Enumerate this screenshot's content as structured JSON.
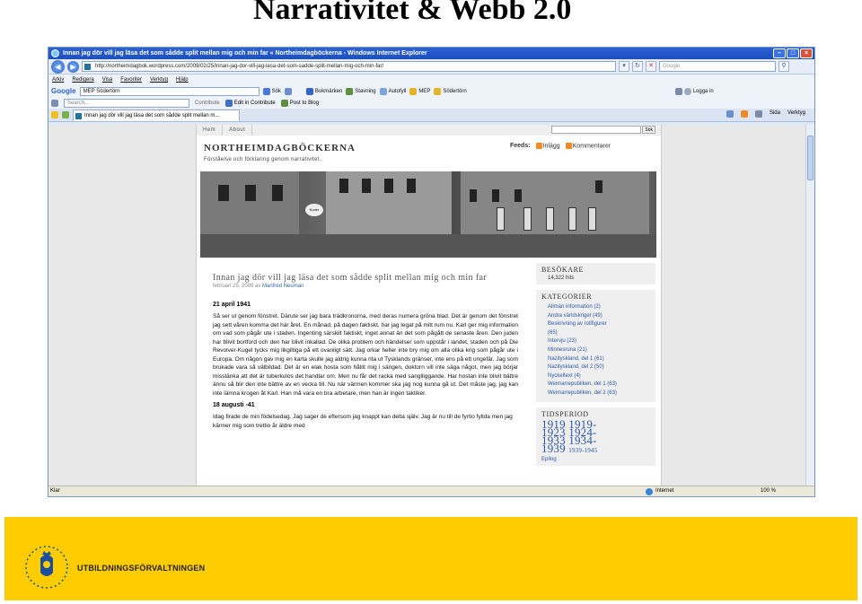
{
  "slide": {
    "title": "Narrativitet & Webb 2.0",
    "org_name": "UTBILDNINGSFÖRVALTNINGEN",
    "logo_letters": "S·T·O·C·K·H·O·L·M·S·S·T·A·D"
  },
  "browser": {
    "window_title": "Innan jag dör vill jag läsa det som sådde split mellan mig och min far « Northeimdagböckerna - Windows Internet Explorer",
    "url": "http://northeimdagbok.wordpress.com/2009/02/25/innan-jag-dor-vill-jag-lasa-det-som-sadde-split-mellan-mig-och-min-far/",
    "search_placeholder": "Google",
    "menu": [
      "Arkiv",
      "Redigera",
      "Visa",
      "Favoriter",
      "Verktyg",
      "Hjälp"
    ],
    "google_toolbar": {
      "logo": "Google",
      "search_value": "MEP Södertörn",
      "items": [
        "Sök",
        "Bokmärken",
        "Stavning",
        "Autofyll",
        "MEP",
        "Södertörn"
      ],
      "login": "Logga in"
    },
    "mep_toolbar": {
      "search_placeholder": "Search...",
      "items": [
        "Contribute",
        "Edit in Contribute",
        "Post to Blog"
      ]
    },
    "tab_label": "Innan jag dör vill jag läsa det som sådde split mellan m...",
    "tab_tools": [
      "Sida",
      "Verktyg"
    ],
    "status": {
      "left": "Klar",
      "zone": "Internet",
      "zoom": "100 %"
    }
  },
  "blog": {
    "nav": [
      "Hem",
      "About"
    ],
    "search_button": "Sök",
    "title": "Northeimdagböckerna",
    "subtitle": "Förståelse och förklaring genom narrativitet.",
    "feeds_label": "Feeds:",
    "feeds": [
      "Inlägg",
      "Kommentarer"
    ],
    "banner_sign": "Kurier",
    "post": {
      "title": "Innan jag dör vill jag läsa det som sådde split mellan mig och min far",
      "date_prefix": "februari 25, 2009 av",
      "author": "Manfred Neuman",
      "entry1_date": "21 april 1941",
      "entry1_text": "Så ser ut genom fönstret. Därute ser jag bara trädkronorna, med deras numera gröna blad. Det är genom det fönstret jag sett våren komma det här året. En månad, på dagen faktiskt, har jag legat på mitt rum nu. Karl ger mig information om vad som pågår ute i staden. Ingenting särskilt faktiskt, inget annat än det som pågått de senaste åren. Den juden har blivit bortford och den har blivit inkallad. De olika problem och händelser som uppstår i landet, staden och på Die Revolver-Kugel tycks mig likgiltiga på ett ovanligt sätt. Jag orkar heller inte bry mig om alla olika krig som pågår ute i Europa. Om någon gav mig en karta skulle jag aldrig kunna rita ut Tysklands gränser, inte ens på ett ungefär. Jag som brukade vara så välbildad. Det är en elak hosta som hållit mig i sängen, doktorn vill inte säga något, men jag börjar misstänka att det är tuberkulos det handlar om. Men nu får det racka med sanglliggande. Har hostan inte blivit bättre ännu så blir den inte bättre av en vecka till. Nu när värmen kommer ska jag nog kunna gå ut. Det måste jag, jag kan inte lämna krogen åt Karl. Han må vara en bra arbetare, men han är ingen taktiker.",
      "entry2_date": "18 augusti -41",
      "entry2_text": "Idag firade de min födelsedag. Jag sager de eftersom jag knappt kan delta själv. Jag är nu till de fyrtio fyllda men jag känner mig som trettio år äldre med"
    },
    "sidebar": {
      "visitors_title": "Besökare",
      "visitors_count": "14,322 hits",
      "categories_title": "Kategorier",
      "categories": [
        "Allmän information (2)",
        "Andra världskriget (49)",
        "Beskrivning av rollfigurer",
        "(65)",
        "Intervju (23)",
        "Minnesruna (21)",
        "Nazityskland, del 1 (61)",
        "Nazityskland, del 2 (50)",
        "Nyckeltext (4)",
        "Weimarrepubliken, del 1 (63)",
        "Weimarrepubliken, del 2 (63)"
      ],
      "period_title": "Tidsperiod",
      "period_line1": "1919 1919-",
      "period_line2": "1923 1924-",
      "period_line3": "1933 1934-",
      "period_line4": "1939",
      "period_line4_small": "1939-1945",
      "epilog": "Epilog"
    }
  }
}
